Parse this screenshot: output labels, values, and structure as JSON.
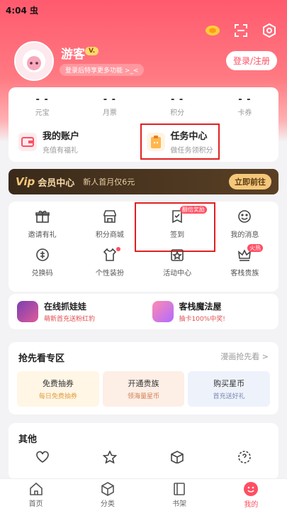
{
  "status": {
    "time": "4:04",
    "carrier_glyph": "虫"
  },
  "user": {
    "name": "游客",
    "vip_badge": "V.",
    "login_hint": "登录后特享更多功能 >_<",
    "login_button": "登录/注册"
  },
  "stats": [
    {
      "value": "- -",
      "label": "元宝"
    },
    {
      "value": "- -",
      "label": "月票"
    },
    {
      "value": "- -",
      "label": "积分"
    },
    {
      "value": "- -",
      "label": "卡券"
    }
  ],
  "account": {
    "title": "我的账户",
    "subtitle": "充值有福礼"
  },
  "tasks": {
    "title": "任务中心",
    "subtitle": "做任务领积分"
  },
  "vip": {
    "logo": "Vip",
    "title": "会员中心",
    "promo": "新人首月仅6元",
    "button": "立即前往"
  },
  "grid": [
    {
      "label": "邀请有礼",
      "icon": "gift-icon"
    },
    {
      "label": "积分商城",
      "icon": "store-icon"
    },
    {
      "label": "签到",
      "icon": "checkin-icon",
      "tag": "翻倍奖励"
    },
    {
      "label": "我的消息",
      "icon": "smile-icon"
    },
    {
      "label": "兑换码",
      "icon": "code-icon"
    },
    {
      "label": "个性装扮",
      "icon": "shirt-icon"
    },
    {
      "label": "活动中心",
      "icon": "star-icon"
    },
    {
      "label": "客栈贵族",
      "icon": "crown-icon",
      "tag": "火热"
    }
  ],
  "promos": [
    {
      "title": "在线抓娃娃",
      "subtitle": "萌新首充送粉红豹"
    },
    {
      "title": "客栈魔法屋",
      "subtitle": "抽卡100%中奖!"
    }
  ],
  "first_zone": {
    "title": "抢先看专区",
    "more": "漫画抢先看 >",
    "boxes": [
      {
        "title": "免费抽券",
        "subtitle": "每日免费抽券"
      },
      {
        "title": "开通贵族",
        "subtitle": "领海量星币"
      },
      {
        "title": "购买星币",
        "subtitle": "首充送好礼"
      }
    ]
  },
  "other": {
    "title": "其他"
  },
  "tabs": [
    {
      "label": "首页",
      "icon": "home-icon"
    },
    {
      "label": "分类",
      "icon": "category-icon"
    },
    {
      "label": "书架",
      "icon": "bookshelf-icon"
    },
    {
      "label": "我的",
      "icon": "mine-icon",
      "active": true
    }
  ],
  "colors": {
    "accent": "#ff4e62",
    "highlight_outline": "#e02020"
  }
}
